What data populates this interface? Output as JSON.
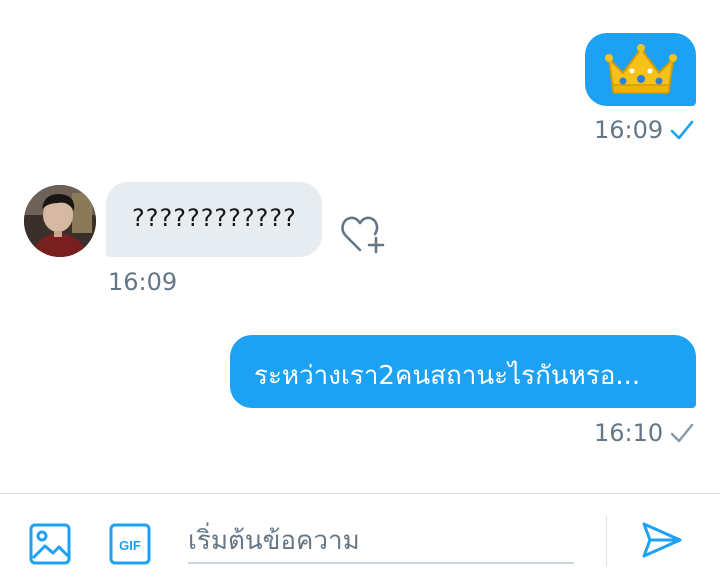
{
  "colors": {
    "accent": "#1da1f2",
    "incoming_bubble": "#e6ecf0",
    "timestamp": "#657786",
    "read_check": "#1da1f2",
    "sent_check": "#8899a6"
  },
  "messages": [
    {
      "direction": "outgoing",
      "content_icon": "crown-emoji",
      "time": "16:09",
      "status_icon": "read-check-icon"
    },
    {
      "direction": "incoming",
      "text": "????????????",
      "time": "16:09",
      "reaction_icon": "heart-plus-icon"
    },
    {
      "direction": "outgoing",
      "text": "ระหว่างเรา2คนสถานะไรกันหรอ...",
      "time": "16:10",
      "status_icon": "sent-check-icon"
    }
  ],
  "composer": {
    "placeholder": "เริ่มต้นข้อความ",
    "gif_label": "GIF"
  }
}
